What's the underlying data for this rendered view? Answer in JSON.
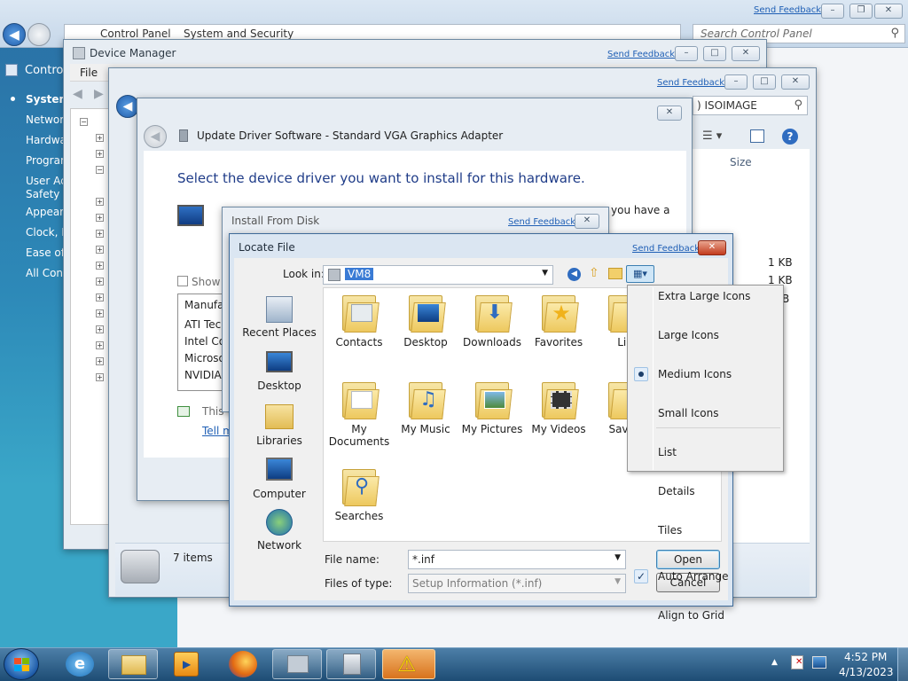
{
  "control_panel": {
    "feedback": "Send Feedback",
    "breadcrumb": [
      "Control Panel",
      "System and Security"
    ],
    "search_placeholder": "Search Control Panel",
    "sidebar_title": "Control",
    "sidebar_items": [
      "System",
      "Network",
      "Hardwa",
      "Program",
      "User Acc",
      "Safety",
      "Appeara",
      "Clock, L",
      "Ease of A",
      "All Cont"
    ]
  },
  "device_manager": {
    "title": "Device Manager",
    "feedback": "Send Feedback",
    "menu_file": "File"
  },
  "explorer": {
    "feedback": "Send Feedback",
    "search_text": ") ISOIMAGE",
    "col_size": "Size",
    "sizes": [
      "1 KB",
      "1 KB",
      "B"
    ],
    "items_count": "7 items"
  },
  "update_driver": {
    "title": "Update Driver Software - Standard VGA Graphics Adapter",
    "heading": "Select the device driver you want to install for this hardware.",
    "you_have": "you have a",
    "show": "Show",
    "manufacturer_header": "Manufa",
    "manufacturers": [
      "ATI Tec",
      "Intel Co",
      "Microso",
      "NVIDIA"
    ],
    "this_text": "This",
    "tell_link": "Tell m"
  },
  "install_from_disk": {
    "title": "Install From Disk",
    "feedback": "Send Feedback"
  },
  "locate_file": {
    "title": "Locate File",
    "feedback": "Send Feedback",
    "look_in_label": "Look in:",
    "look_in_value": "VM8",
    "places": [
      "Recent Places",
      "Desktop",
      "Libraries",
      "Computer",
      "Network"
    ],
    "files_row1": [
      "Contacts",
      "Desktop",
      "Downloads",
      "Favorites",
      "Lin"
    ],
    "files_row2": [
      "My Documents",
      "My Music",
      "My Pictures",
      "My Videos",
      "Saved"
    ],
    "files_row3": [
      "Searches"
    ],
    "file_name_label": "File name:",
    "file_name_value": "*.inf",
    "files_of_type_label": "Files of type:",
    "files_of_type_value": "Setup Information (*.inf)",
    "open_label": "Open",
    "cancel_label": "Cancel"
  },
  "view_menu": {
    "items": [
      "Extra Large Icons",
      "Large Icons",
      "Medium Icons",
      "Small Icons",
      "List",
      "Details",
      "Tiles"
    ],
    "items2": [
      "Auto Arrange",
      "Align to Grid"
    ],
    "selected": "Medium Icons",
    "checked": "Auto Arrange"
  },
  "taskbar": {
    "time": "4:52 PM",
    "date": "4/13/2023"
  }
}
